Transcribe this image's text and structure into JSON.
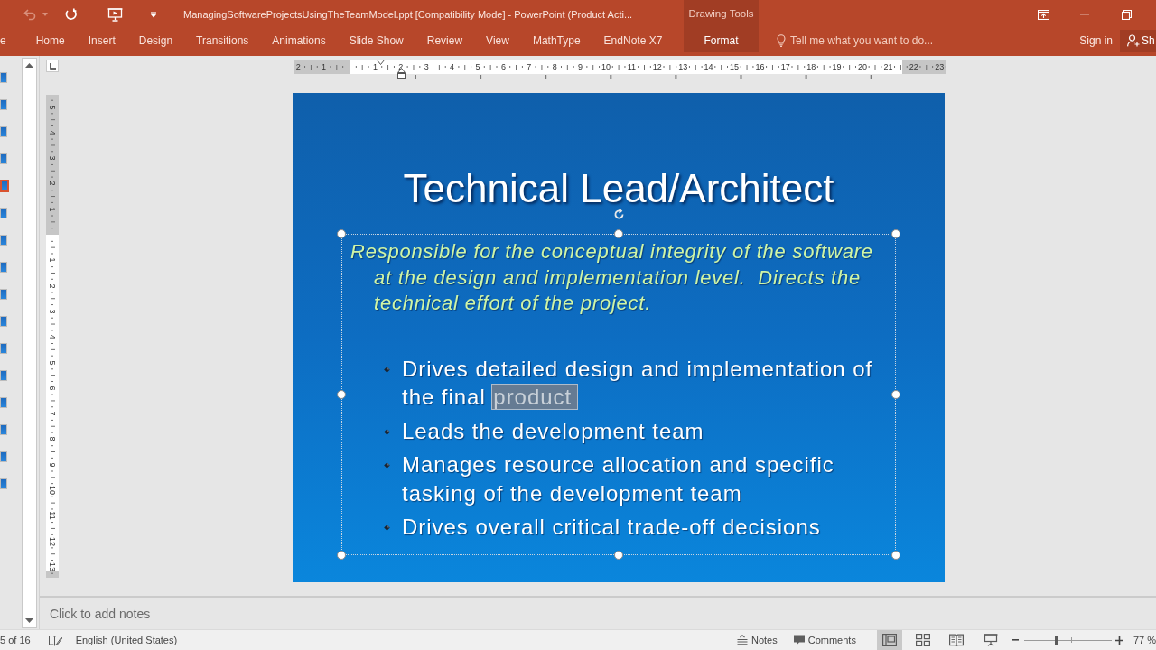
{
  "title_bar": {
    "quick_access": [
      {
        "disabled": true
      },
      {
        "disabled": true
      },
      {
        "disabled": false
      },
      {
        "disabled": false
      },
      {
        "disabled": false
      }
    ],
    "title": "ManagingSoftwareProjectsUsingTheTeamModel.ppt [Compatibility Mode] - PowerPoint (Product Acti..."
  },
  "ribbon": {
    "tabs": [
      {
        "label": "e",
        "selected": false
      },
      {
        "label": "Home",
        "selected": false
      },
      {
        "label": "Insert",
        "selected": false
      },
      {
        "label": "Design",
        "selected": false
      },
      {
        "label": "Transitions",
        "selected": false
      },
      {
        "label": "Animations",
        "selected": false
      },
      {
        "label": "Slide Show",
        "selected": false
      },
      {
        "label": "Review",
        "selected": false
      },
      {
        "label": "View",
        "selected": false
      },
      {
        "label": "MathType",
        "selected": false
      },
      {
        "label": "EndNote X7",
        "selected": false
      }
    ],
    "contextual_group": {
      "label": "Drawing Tools",
      "tabs": [
        {
          "label": "Format",
          "selected": false
        }
      ]
    },
    "tell_me": {
      "placeholder": "Tell me what you want to do..."
    },
    "sign_in": "Sign in",
    "share": "Sh"
  },
  "slide_thumbnails": [
    {
      "selected": false
    },
    {
      "selected": false
    },
    {
      "selected": false
    },
    {
      "selected": false
    },
    {
      "selected": true
    },
    {
      "selected": false
    },
    {
      "selected": false
    },
    {
      "selected": false
    },
    {
      "selected": false
    },
    {
      "selected": false
    },
    {
      "selected": false
    },
    {
      "selected": false
    },
    {
      "selected": false
    },
    {
      "selected": false
    },
    {
      "selected": false
    },
    {
      "selected": false
    }
  ],
  "rulers": {
    "horizontal": {
      "before": [
        "2",
        "1"
      ],
      "after": [
        "1",
        "2",
        "3",
        "4",
        "5",
        "6",
        "7",
        "8",
        "9",
        "10",
        "11",
        "12",
        "13",
        "14",
        "15",
        "16",
        "17",
        "18",
        "19",
        "20",
        "21",
        "22",
        "23"
      ]
    },
    "vertical": {
      "before": [
        "5",
        "4",
        "3",
        "2",
        "1"
      ],
      "after": [
        "1",
        "2",
        "3",
        "4",
        "5",
        "6",
        "7",
        "8",
        "9",
        "10",
        "11",
        "12",
        "13"
      ]
    }
  },
  "slide": {
    "title": "Technical Lead/Architect",
    "text_box": {
      "selected": true,
      "intro": "Responsible for the conceptual integrity of the software at the design and implementation level.  Directs the technical effort of the project.",
      "bullets": [
        {
          "segments": [
            {
              "text": "Drives detailed design and implementation of the final ",
              "selected": false
            },
            {
              "text": "product",
              "selected": true
            }
          ]
        },
        {
          "segments": [
            {
              "text": "Leads the development team",
              "selected": false
            }
          ]
        },
        {
          "segments": [
            {
              "text": "Manages resource allocation and specific tasking of the development team",
              "selected": false
            }
          ]
        },
        {
          "segments": [
            {
              "text": "Drives overall critical trade-off decisions",
              "selected": false
            }
          ]
        }
      ]
    }
  },
  "notes": {
    "placeholder": "Click to add notes"
  },
  "status_bar": {
    "slide_position": "5 of 16",
    "language": "English (United States)",
    "notes_button": "Notes",
    "comments_button": "Comments",
    "views": [
      {
        "selected": true
      },
      {
        "selected": false
      },
      {
        "selected": false
      },
      {
        "selected": false
      }
    ],
    "zoom": {
      "level": 0.37,
      "reading": "77 %"
    }
  }
}
